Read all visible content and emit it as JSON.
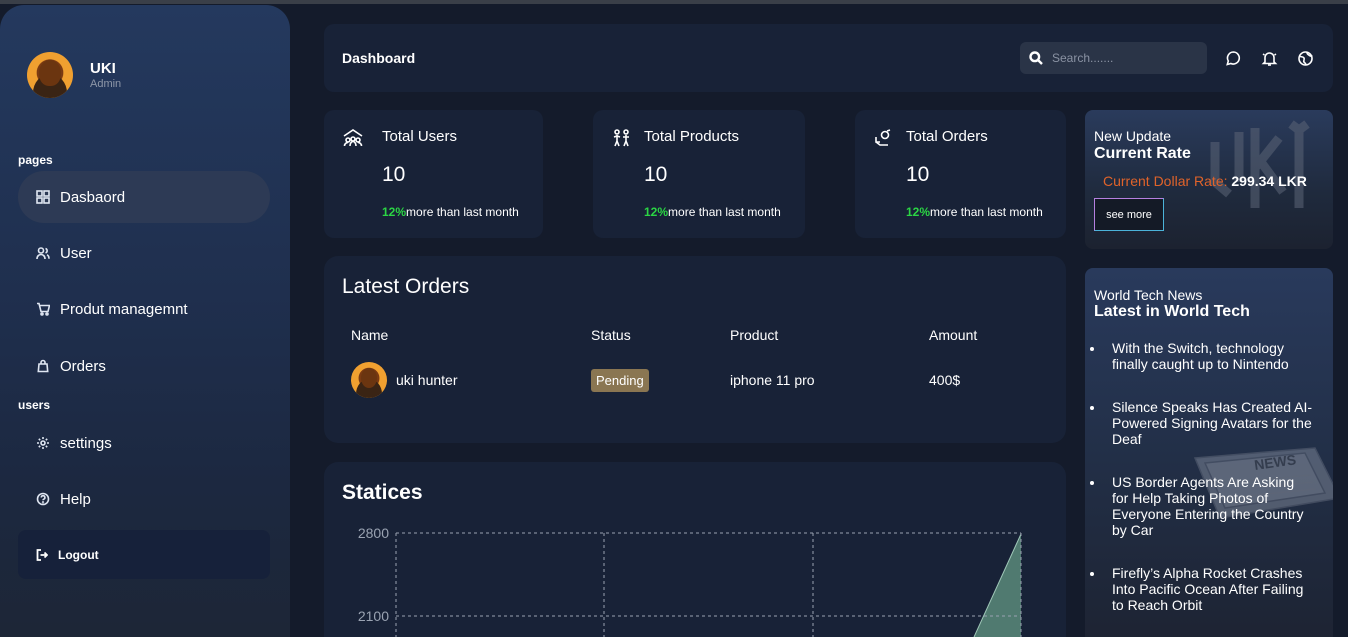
{
  "user": {
    "name": "UKI",
    "role": "Admin"
  },
  "sidebar": {
    "section_pages": "pages",
    "section_users": "users",
    "items": [
      {
        "label": "Dasbaord",
        "icon": "dashboard-icon"
      },
      {
        "label": "User",
        "icon": "users-icon"
      },
      {
        "label": "Produt managemnt",
        "icon": "cart-icon"
      },
      {
        "label": "Orders",
        "icon": "bag-icon"
      },
      {
        "label": "settings",
        "icon": "gear-icon"
      },
      {
        "label": "Help",
        "icon": "help-icon"
      }
    ],
    "logout_label": "Logout"
  },
  "header": {
    "title": "Dashboard",
    "search_placeholder": "Search......."
  },
  "stats": [
    {
      "title": "Total Users",
      "value": "10",
      "pct": "12%",
      "foot": "more than last month",
      "icon": "users-group-icon"
    },
    {
      "title": "Total Products",
      "value": "10",
      "pct": "12%",
      "foot": "more than last month",
      "icon": "products-icon"
    },
    {
      "title": "Total Orders",
      "value": "10",
      "pct": "12%",
      "foot": "more than last month",
      "icon": "orders-icon"
    }
  ],
  "orders": {
    "title": "Latest Orders",
    "headers": [
      "Name",
      "Status",
      "Product",
      "Amount"
    ],
    "rows": [
      {
        "name": "uki hunter",
        "status": "Pending",
        "product": "iphone 11 pro",
        "amount": "400$"
      }
    ]
  },
  "statistics": {
    "title": "Statices",
    "y_ticks": [
      "2800",
      "2100"
    ]
  },
  "rate_card": {
    "kicker": "New Update",
    "title": "Current Rate",
    "label": "Current Dollar Rate: ",
    "value": "299.34 LKR",
    "button": "see more",
    "watermark": "UKI"
  },
  "news": {
    "kicker": "World Tech News",
    "title": "Latest in World Tech",
    "items": [
      "With the Switch, technology finally caught up to Nintendo",
      "Silence Speaks Has Created AI-Powered Signing Avatars for the Deaf",
      "US Border Agents Are Asking for Help Taking Photos of Everyone Entering the Country by Car",
      "Firefly’s Alpha Rocket Crashes Into Pacific Ocean After Failing to Reach Orbit"
    ]
  },
  "colors": {
    "accent_green": "#2bd544",
    "rate_orange": "#e0632a",
    "pending_badge": "#8a7652"
  }
}
